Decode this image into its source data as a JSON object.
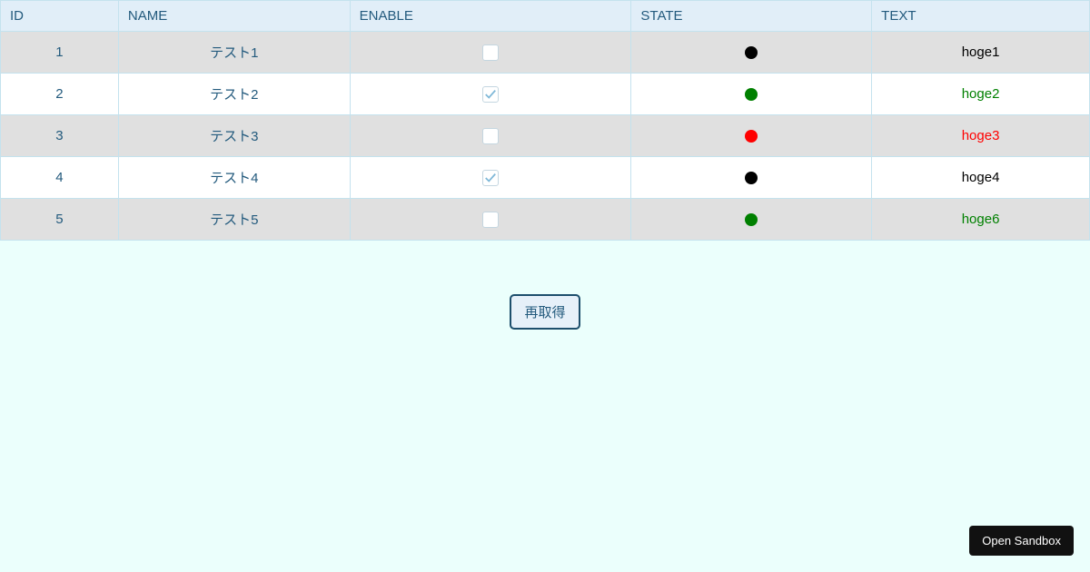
{
  "table": {
    "headers": {
      "id": "ID",
      "name": "NAME",
      "enable": "ENABLE",
      "state": "STATE",
      "text": "TEXT"
    },
    "rows": [
      {
        "id": "1",
        "name": "テスト1",
        "enable": false,
        "state": "black",
        "text": "hoge1",
        "text_color": "black"
      },
      {
        "id": "2",
        "name": "テスト2",
        "enable": true,
        "state": "green",
        "text": "hoge2",
        "text_color": "green"
      },
      {
        "id": "3",
        "name": "テスト3",
        "enable": false,
        "state": "red",
        "text": "hoge3",
        "text_color": "red"
      },
      {
        "id": "4",
        "name": "テスト4",
        "enable": true,
        "state": "black",
        "text": "hoge4",
        "text_color": "black"
      },
      {
        "id": "5",
        "name": "テスト5",
        "enable": false,
        "state": "green",
        "text": "hoge6",
        "text_color": "green"
      }
    ]
  },
  "buttons": {
    "refresh": "再取得",
    "sandbox": "Open Sandbox"
  }
}
